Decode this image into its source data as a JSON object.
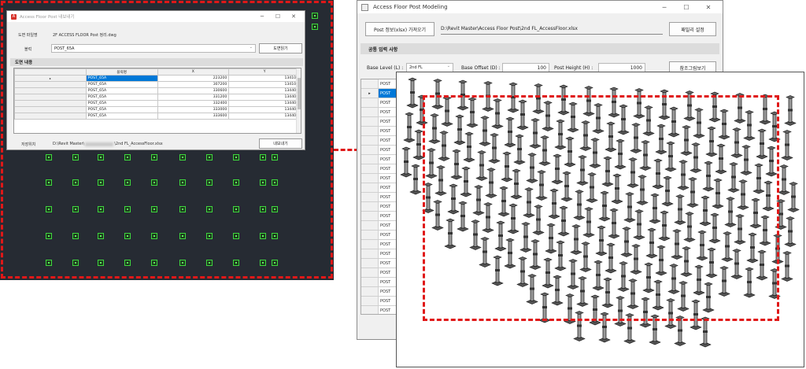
{
  "import_dialog": {
    "title": "Access Floor Post 내보내기",
    "drawing_file_label": "도면 파일명",
    "drawing_file_value": "2F ACCESS FLOOR Post 정리.dwg",
    "block_label": "블럭",
    "block_value": "POST_65A",
    "open_drawing_button": "도면읽기",
    "drawing_info_header": "도면 내용",
    "grid_columns": [
      "블럭명",
      "X",
      "Y"
    ],
    "grid_rows": [
      {
        "name": "POST_65A",
        "x": "223200",
        "y": "134100"
      },
      {
        "name": "POST_65A",
        "x": "307200",
        "y": "134100"
      },
      {
        "name": "POST_65A",
        "x": "330600",
        "y": "134401"
      },
      {
        "name": "POST_65A",
        "x": "331200",
        "y": "134401"
      },
      {
        "name": "POST_65A",
        "x": "332400",
        "y": "134401"
      },
      {
        "name": "POST_65A",
        "x": "333000",
        "y": "134401"
      },
      {
        "name": "POST_65A",
        "x": "333600",
        "y": "134401"
      }
    ],
    "save_location_label": "저장위치",
    "save_path_start": "D:\\Revit Master\\",
    "save_path_end": "\\2nd FL_AccessFloor.xlsx",
    "export_button": "내보내기"
  },
  "model_window": {
    "title": "Access Floor Post Modeling",
    "import_post_button": "Post 정보(xlsx) 가져오기",
    "post_file_path": "D:\\Revit Master\\Access Floor Post\\2nd FL_AccessFloor.xlsx",
    "family_settings_button": "패밀리 설정",
    "common_input_header": "공통 입력 사항",
    "base_level_label": "Base Level (L) :",
    "base_level_value": "2nd FL",
    "base_offset_label": "Base Offset (D) :",
    "base_offset_value": "100",
    "post_height_label": "Post Height (H) :",
    "post_height_value": "1000",
    "reference_view_button": "참조그림보기",
    "row_labels": [
      "POST"
    ]
  },
  "colors": {
    "highlight": "#e01818",
    "cad_background": "#262b33",
    "cad_post": "#3ed63e",
    "selection": "#0078d7"
  }
}
